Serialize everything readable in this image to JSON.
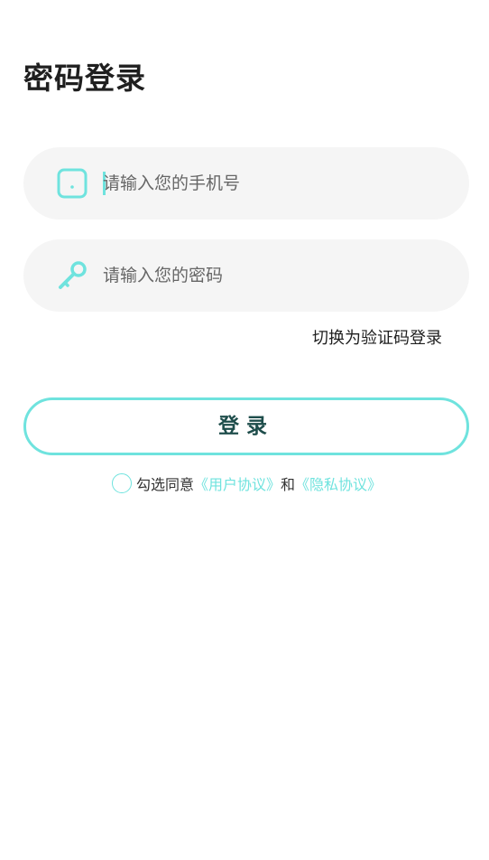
{
  "page": {
    "title": "密码登录"
  },
  "form": {
    "phone": {
      "placeholder": "请输入您的手机号",
      "icon": "phone-icon"
    },
    "password": {
      "placeholder": "请输入您的密码",
      "icon": "key-icon"
    },
    "switch_label": "切换为验证码登录",
    "login_label": "登录"
  },
  "agreement": {
    "prefix": "勾选同意",
    "user_agreement": "《用户协议》",
    "conjunction": "和",
    "privacy_agreement": "《隐私协议》"
  },
  "colors": {
    "accent": "#6fe3de",
    "field_bg": "#f5f5f5",
    "button_text": "#1e4d4b"
  }
}
